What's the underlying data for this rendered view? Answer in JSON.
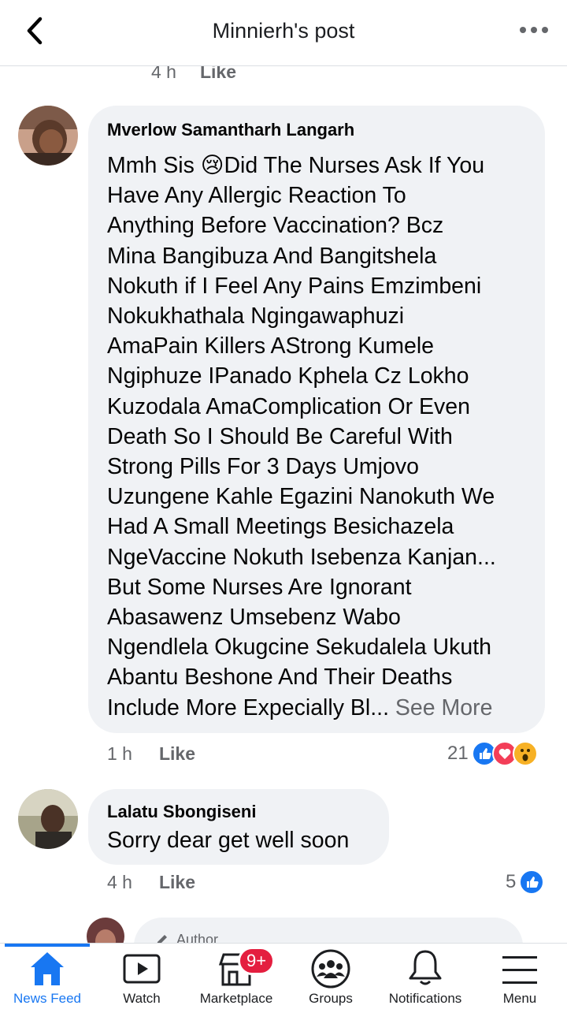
{
  "header": {
    "title": "Minnierh's post"
  },
  "previous_comment": {
    "time": "4 h",
    "like_label": "Like"
  },
  "comments": [
    {
      "author": "Mverlow Samantharh Langarh",
      "text_lines": [
        "Mmh Sis 😢Did The Nurses Ask If You",
        "Have Any Allergic Reaction To",
        "Anything Before Vaccination? Bcz",
        "Mina Bangibuza And Bangitshela",
        "Nokuth if I Feel Any Pains Emzimbeni",
        "Nokukhathala Ngingawaphuzi",
        "AmaPain Killers AStrong Kumele",
        "Ngiphuze IPanado Kphela Cz Lokho",
        "Kuzodala AmaComplication Or Even",
        "Death So I Should Be Careful With",
        "Strong Pills For 3 Days Umjovo",
        "Uzungene Kahle Egazini Nanokuth We",
        "Had A Small Meetings Besichazela",
        "NgeVaccine Nokuth Isebenza Kanjan...",
        "But Some Nurses Are Ignorant",
        "Abasawenz Umsebenz Wabo",
        "Ngendlela Okugcine Sekudalela Ukuth",
        "Abantu Beshone And Their Deaths"
      ],
      "last_line": "Include More Expecially  Bl...",
      "see_more": "See More",
      "time": "1 h",
      "like_label": "Like",
      "reaction_count": "21",
      "reactions": [
        "like-icon",
        "love-icon",
        "wow-icon"
      ]
    },
    {
      "author": "Lalatu Sbongiseni",
      "text": "Sorry dear get well soon",
      "time": "4 h",
      "like_label": "Like",
      "reaction_count": "5",
      "reactions": [
        "like-icon"
      ]
    }
  ],
  "author_reply": {
    "badge": "Author"
  },
  "tabbar": {
    "tabs": [
      {
        "label": "News Feed",
        "icon": "home-icon",
        "active": true
      },
      {
        "label": "Watch",
        "icon": "watch-icon"
      },
      {
        "label": "Marketplace",
        "icon": "marketplace-icon",
        "badge": "9+"
      },
      {
        "label": "Groups",
        "icon": "groups-icon"
      },
      {
        "label": "Notifications",
        "icon": "bell-icon"
      },
      {
        "label": "Menu",
        "icon": "menu-icon"
      }
    ]
  },
  "colors": {
    "accent": "#1877f2",
    "bubble": "#f0f2f5",
    "muted_text": "#65676b",
    "badge": "#e41e3f",
    "love": "#f33e58",
    "wow": "#f7b125"
  }
}
